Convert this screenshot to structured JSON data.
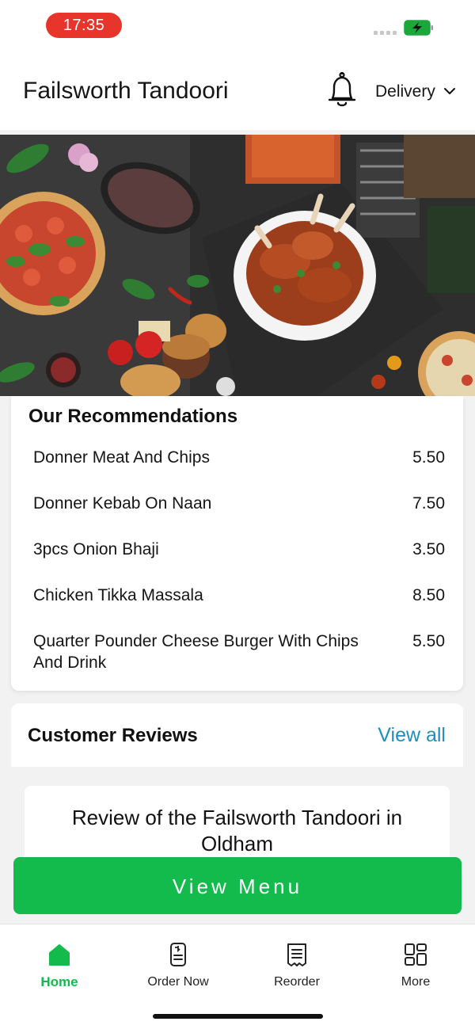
{
  "status_bar": {
    "time": "17:35",
    "battery_color": "#1aa83a",
    "time_pill_color": "#e8352c"
  },
  "header": {
    "title": "Failsworth Tandoori",
    "bell_icon": "bell-icon",
    "mode_label": "Delivery",
    "mode_icon": "chevron-down-icon"
  },
  "recommendations": {
    "title": "Our Recommendations",
    "items": [
      {
        "name": "Donner Meat And Chips",
        "price": "5.50"
      },
      {
        "name": "Donner Kebab On Naan",
        "price": "7.50"
      },
      {
        "name": "3pcs Onion Bhaji",
        "price": "3.50"
      },
      {
        "name": "Chicken Tikka Massala",
        "price": "8.50"
      },
      {
        "name": "Quarter Pounder Cheese Burger With Chips And Drink",
        "price": "5.50"
      }
    ]
  },
  "reviews": {
    "title": "Customer Reviews",
    "view_all_label": "View all",
    "first_review_title": "Review of the Failsworth Tandoori in Oldham"
  },
  "view_menu_label": "View Menu",
  "bottom_nav": {
    "items": [
      {
        "label": "Home",
        "icon": "home-icon",
        "active": true
      },
      {
        "label": "Order Now",
        "icon": "phone-order-icon",
        "active": false
      },
      {
        "label": "Reorder",
        "icon": "receipt-icon",
        "active": false
      },
      {
        "label": "More",
        "icon": "grid-icon",
        "active": false
      }
    ]
  },
  "colors": {
    "accent_green": "#13bb4c",
    "link_blue": "#1e8fbd"
  }
}
